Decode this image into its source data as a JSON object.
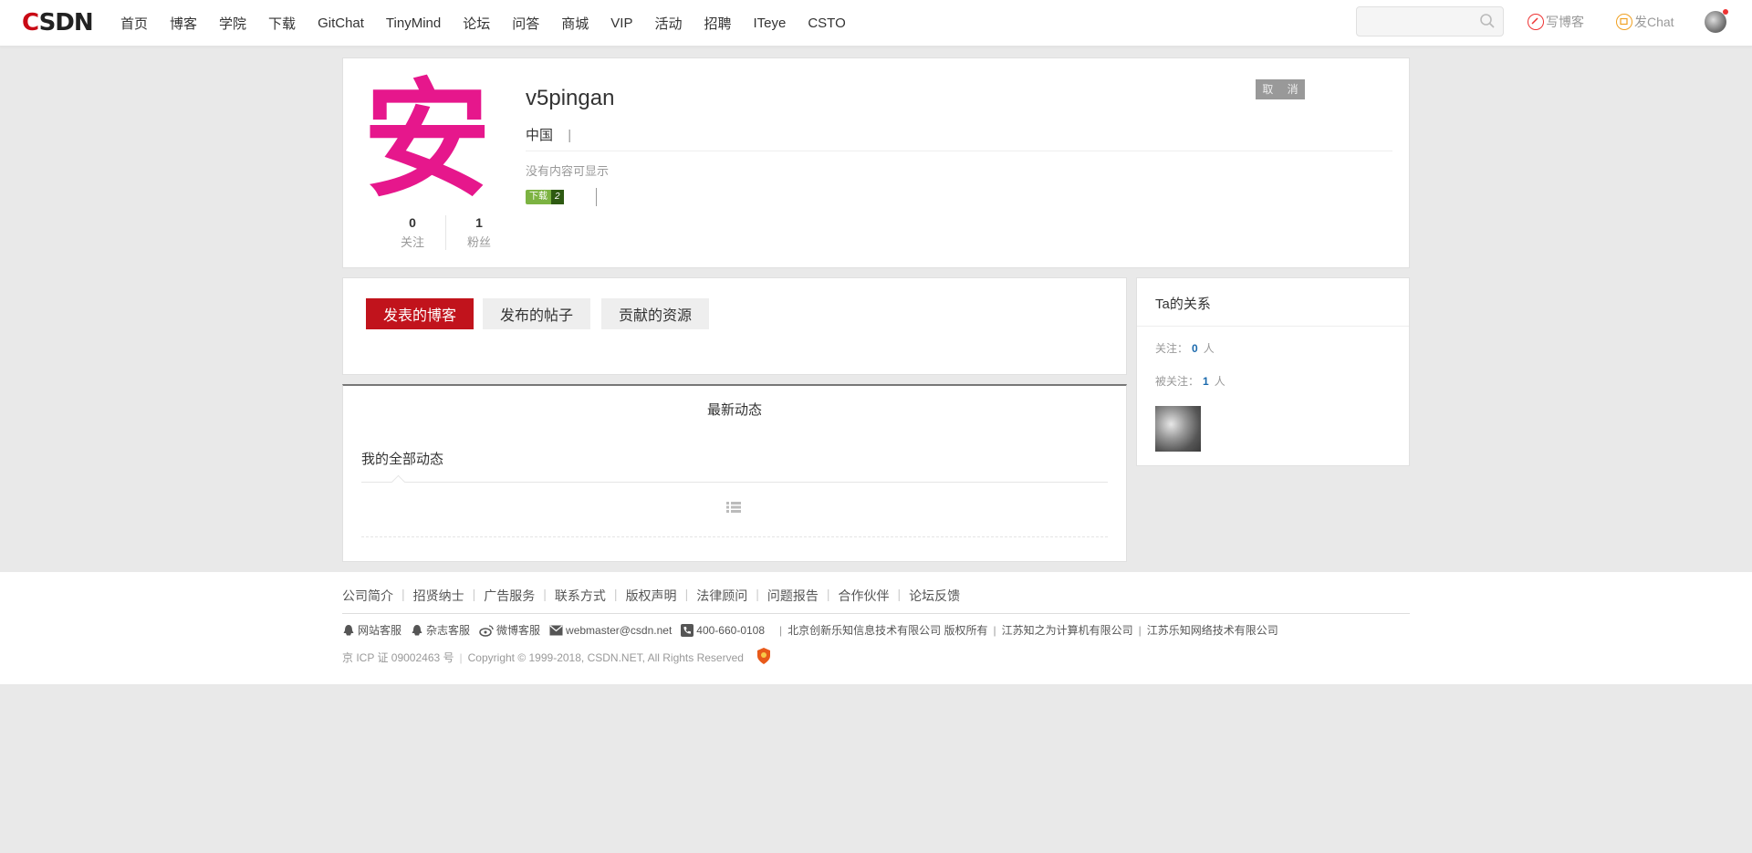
{
  "header": {
    "logo": "CSDN",
    "nav": [
      "首页",
      "博客",
      "学院",
      "下载",
      "GitChat",
      "TinyMind",
      "论坛",
      "问答",
      "商城",
      "VIP",
      "活动",
      "招聘",
      "ITeye",
      "CSTO"
    ],
    "search_placeholder": "",
    "write_blog": "写博客",
    "post_chat": "发Chat"
  },
  "profile": {
    "avatar_char": "安",
    "username": "v5pingan",
    "location": "中国",
    "location_sep": "|",
    "empty_text": "没有内容可显示",
    "badge_label": "下载",
    "badge_level": "2",
    "cancel_label": "取 消",
    "following_count": "0",
    "following_label": "关注",
    "fans_count": "1",
    "fans_label": "粉丝"
  },
  "tabs": [
    "发表的博客",
    "发布的帖子",
    "贡献的资源"
  ],
  "relations": {
    "title": "Ta的关系",
    "following_label": "关注：",
    "following_value": "0",
    "followers_label": "被关注：",
    "followers_value": "1",
    "unit": "人"
  },
  "feed": {
    "title": "最新动态",
    "subtitle": "我的全部动态"
  },
  "footer": {
    "links": [
      "公司简介",
      "招贤纳士",
      "广告服务",
      "联系方式",
      "版权声明",
      "法律顾问",
      "问题报告",
      "合作伙伴",
      "论坛反馈"
    ],
    "service_site": "网站客服",
    "service_magazine": "杂志客服",
    "service_weibo": "微博客服",
    "email": "webmaster@csdn.net",
    "phone": "400-660-0108",
    "company1": "北京创新乐知信息技术有限公司 版权所有",
    "company2": "江苏知之为计算机有限公司",
    "company3": "江苏乐知网络技术有限公司",
    "icp": "京 ICP 证 09002463 号",
    "copyright": "Copyright © 1999-2018, CSDN.NET, All Rights Reserved"
  },
  "colors": {
    "brand_red": "#c90a15",
    "active_tab": "#c1131c",
    "avatar_magenta": "#e6178c",
    "link_blue": "#1b6aad"
  }
}
